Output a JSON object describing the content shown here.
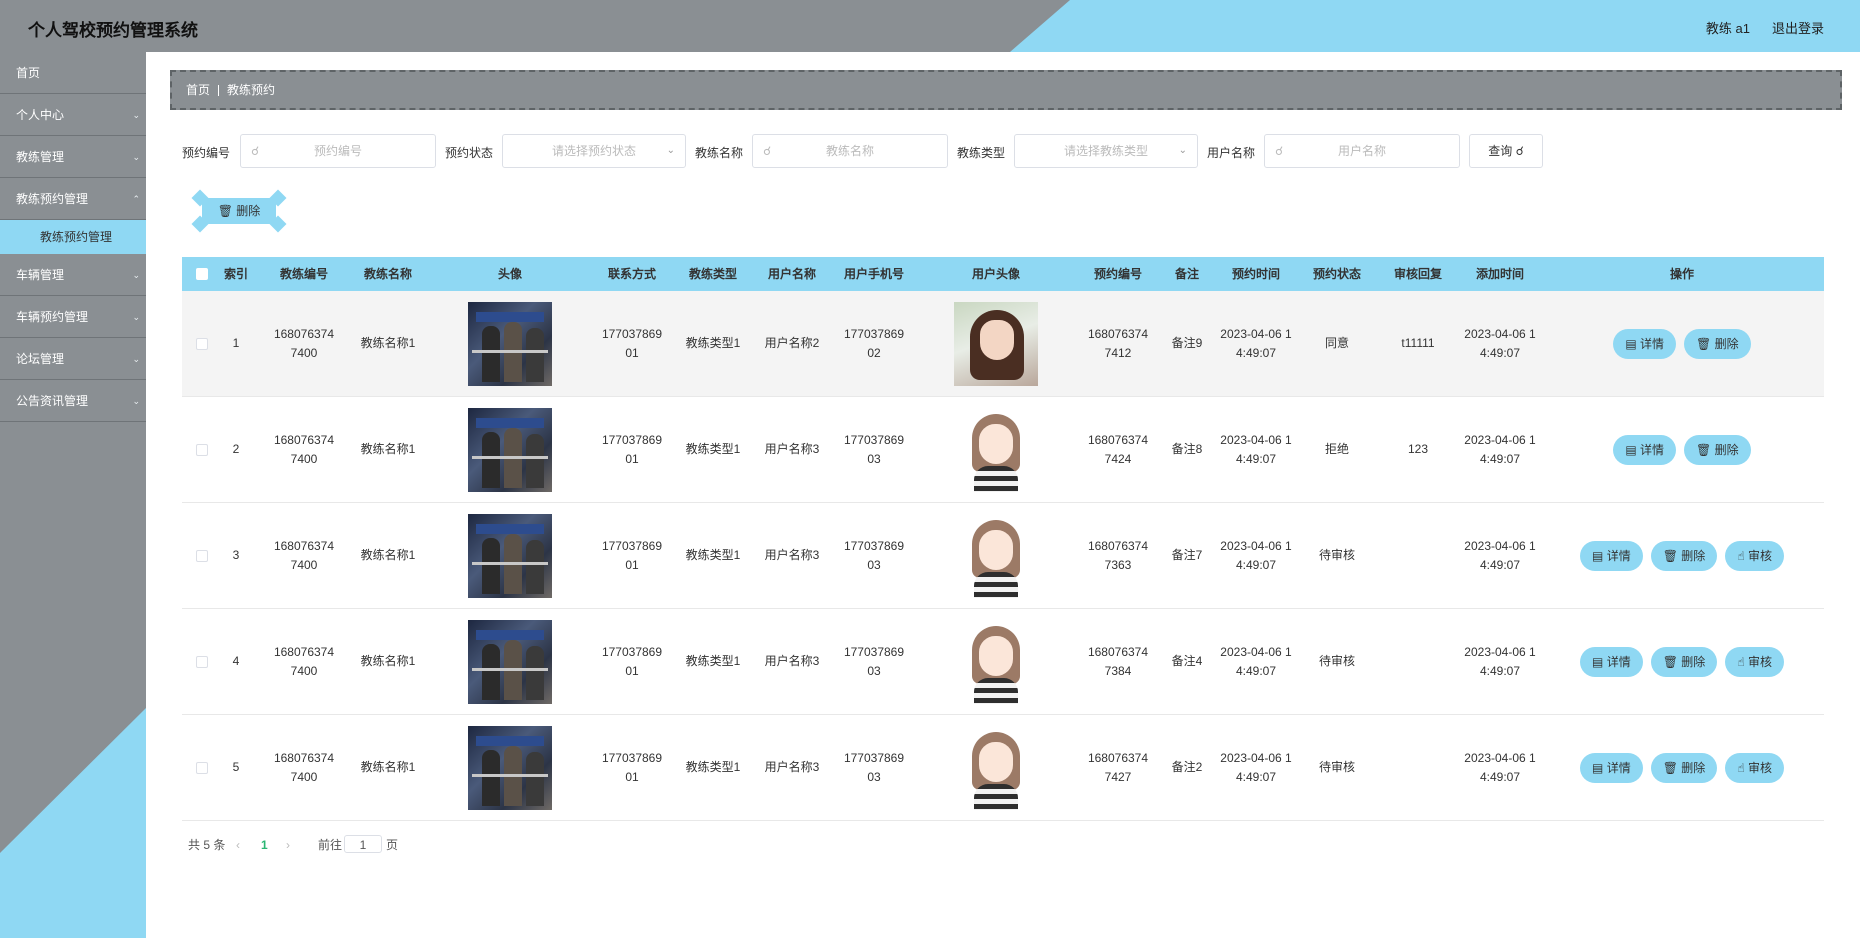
{
  "header": {
    "title": "个人驾校预约管理系统",
    "user": "教练 a1",
    "logout": "退出登录"
  },
  "sidebar": {
    "items": [
      {
        "label": "首页"
      },
      {
        "label": "个人中心"
      },
      {
        "label": "教练管理"
      },
      {
        "label": "教练预约管理"
      },
      {
        "label": "车辆管理"
      },
      {
        "label": "车辆预约管理"
      },
      {
        "label": "论坛管理"
      },
      {
        "label": "公告资讯管理"
      }
    ],
    "active_sub": "教练预约管理"
  },
  "breadcrumb": {
    "home": "首页",
    "current": "教练预约"
  },
  "search": {
    "fields": [
      {
        "label": "预约编号",
        "placeholder": "预约编号"
      },
      {
        "label": "预约状态",
        "placeholder": "请选择预约状态"
      },
      {
        "label": "教练名称",
        "placeholder": "教练名称"
      },
      {
        "label": "教练类型",
        "placeholder": "请选择教练类型"
      },
      {
        "label": "用户名称",
        "placeholder": "用户名称"
      }
    ],
    "query": "查询"
  },
  "toolbar": {
    "delete": "删除"
  },
  "table": {
    "headers": [
      "索引",
      "教练编号",
      "教练名称",
      "头像",
      "联系方式",
      "教练类型",
      "用户名称",
      "用户手机号",
      "用户头像",
      "预约编号",
      "备注",
      "预约时间",
      "预约状态",
      "审核回复",
      "添加时间",
      "操作"
    ],
    "rows": [
      {
        "index": "1",
        "coach_no": "1680763747400",
        "coach_name": "教练名称1",
        "phone": "17703786901",
        "coach_type": "教练类型1",
        "user_name": "用户名称2",
        "user_phone": "17703786902",
        "booking_no": "1680763747412",
        "remark": "备注9",
        "booking_time": "2023-04-06 14:49:07",
        "status": "同意",
        "reply": "t11111",
        "added": "2023-04-06 14:49:07"
      },
      {
        "index": "2",
        "coach_no": "1680763747400",
        "coach_name": "教练名称1",
        "phone": "17703786901",
        "coach_type": "教练类型1",
        "user_name": "用户名称3",
        "user_phone": "17703786903",
        "booking_no": "1680763747424",
        "remark": "备注8",
        "booking_time": "2023-04-06 14:49:07",
        "status": "拒绝",
        "reply": "123",
        "added": "2023-04-06 14:49:07"
      },
      {
        "index": "3",
        "coach_no": "1680763747400",
        "coach_name": "教练名称1",
        "phone": "17703786901",
        "coach_type": "教练类型1",
        "user_name": "用户名称3",
        "user_phone": "17703786903",
        "booking_no": "1680763747363",
        "remark": "备注7",
        "booking_time": "2023-04-06 14:49:07",
        "status": "待审核",
        "reply": "",
        "added": "2023-04-06 14:49:07"
      },
      {
        "index": "4",
        "coach_no": "1680763747400",
        "coach_name": "教练名称1",
        "phone": "17703786901",
        "coach_type": "教练类型1",
        "user_name": "用户名称3",
        "user_phone": "17703786903",
        "booking_no": "1680763747384",
        "remark": "备注4",
        "booking_time": "2023-04-06 14:49:07",
        "status": "待审核",
        "reply": "",
        "added": "2023-04-06 14:49:07"
      },
      {
        "index": "5",
        "coach_no": "1680763747400",
        "coach_name": "教练名称1",
        "phone": "17703786901",
        "coach_type": "教练类型1",
        "user_name": "用户名称3",
        "user_phone": "17703786903",
        "booking_no": "1680763747427",
        "remark": "备注2",
        "booking_time": "2023-04-06 14:49:07",
        "status": "待审核",
        "reply": "",
        "added": "2023-04-06 14:49:07"
      }
    ],
    "actions": {
      "detail": "详情",
      "delete": "删除",
      "review": "审核"
    }
  },
  "pager": {
    "total": "共 5 条",
    "page": "1",
    "goto": "前往",
    "goto_value": "1",
    "unit": "页"
  },
  "colors": {
    "accent": "#8fd8f3",
    "chrome": "#8a8f93",
    "pager_active": "#2bb673"
  }
}
